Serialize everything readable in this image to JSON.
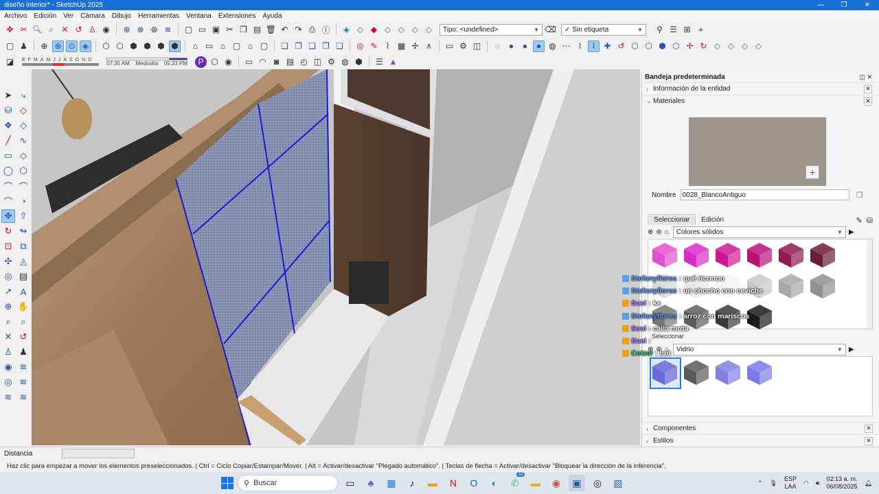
{
  "window": {
    "title": "diseño interior* - SketchUp 2025",
    "controls": [
      "—",
      "❐",
      "✕"
    ]
  },
  "menu": [
    "Archivo",
    "Edición",
    "Ver",
    "Cámara",
    "Dibujo",
    "Herramientas",
    "Ventana",
    "Extensiones",
    "Ayuda"
  ],
  "toolbar": {
    "type_dropdown": "Tipo: <undefined>",
    "tag_dropdown": "Sin etiqueta",
    "shadow_months": [
      "E",
      "F",
      "M",
      "A",
      "M",
      "J",
      "J",
      "A",
      "S",
      "O",
      "N",
      "D"
    ],
    "shadow_time_start": "07:35 AM",
    "shadow_time_mid": "Mediodía",
    "shadow_time_end": "05:33 PM"
  },
  "tray": {
    "title": "Bandeja predeterminada",
    "sections": {
      "entity_info": "Información de la entidad",
      "materials": "Materiales",
      "components": "Componentes",
      "styles": "Estilos"
    },
    "material_name_label": "Nombre",
    "material_name_value": "0028_BlancoAntiguo",
    "tab_select": "Seleccionar",
    "tab_edit": "Edición",
    "library_primary": "Colores sólidos",
    "secondary_select_label": "Seleccionar",
    "library_secondary": "Vidrio",
    "preview_color": "#9c958c"
  },
  "swatches_primary": [
    "#e04fd0",
    "#d92bc7",
    "#d01896",
    "#b8127a",
    "#8e1b4e",
    "#6b1d36",
    "#d8d8d8",
    "#e8e8e8",
    "#f5f5f5",
    "#c8c8c8",
    "#a8a8a8",
    "#909090",
    "#787878",
    "#5e5e5e",
    "#3a3a3a",
    "#1a1a1a"
  ],
  "swatches_secondary": [
    "#6a6ad8",
    "#5a5a5a",
    "#8080e0",
    "#7a7ae8"
  ],
  "chat": [
    {
      "user": "Stefanyflores",
      "msg": ": qué ricoooo",
      "badge": "sub"
    },
    {
      "user": "Stefanyflores",
      "msg": ": un chocho con ceviche",
      "badge": "sub"
    },
    {
      "user": "Suei",
      "msg": ": ke",
      "badge": "vip"
    },
    {
      "user": "Stefanyflores",
      "msg": ": arroz con mariscos",
      "badge": "sub"
    },
    {
      "user": "Suei",
      "msg": ": calla mrda",
      "badge": "vip"
    },
    {
      "user": "Suei",
      "msg": ":",
      "badge": "vip"
    },
    {
      "user": "Coizer",
      "msg": ": bot",
      "badge": "vip"
    }
  ],
  "status": {
    "distance_label": "Distancia",
    "hint": "Haz clic para empezar a mover los elementos preseleccionados. | Ctrl = Ciclo Copiar/Estampar/Mover. | Alt = Activar/desactivar \"Plegado automático\". | Teclas de flecha = Activar/desactivar \"Bloquear la dirección de la inferencia\"."
  },
  "taskbar": {
    "search_placeholder": "Buscar",
    "lang_top": "ESP",
    "lang_bottom": "LAA",
    "time": "02:13 a. m.",
    "date": "06/08/2025",
    "whatsapp_badge": "32"
  }
}
